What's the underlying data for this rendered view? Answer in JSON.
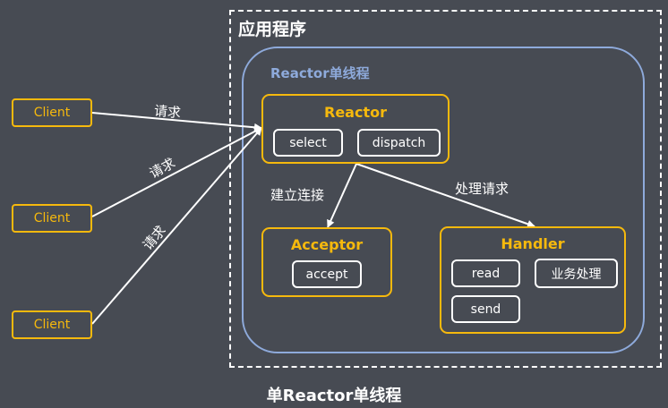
{
  "app": {
    "title": "应用程序",
    "thread_title": "Reactor单线程",
    "footer": "单Reactor单线程"
  },
  "clients": [
    "Client",
    "Client",
    "Client"
  ],
  "request_label": "请求",
  "reactor": {
    "title": "Reactor",
    "methods": [
      "select",
      "dispatch"
    ]
  },
  "acceptor": {
    "title": "Acceptor",
    "methods": [
      "accept"
    ]
  },
  "handler": {
    "title": "Handler",
    "methods": [
      "read",
      "业务处理",
      "send"
    ]
  },
  "edge_labels": {
    "connect": "建立连接",
    "handle": "处理请求"
  },
  "colors": {
    "background": "#474b53",
    "accent": "#f6b90d",
    "thread": "#8eaadb",
    "line": "#ffffff"
  }
}
